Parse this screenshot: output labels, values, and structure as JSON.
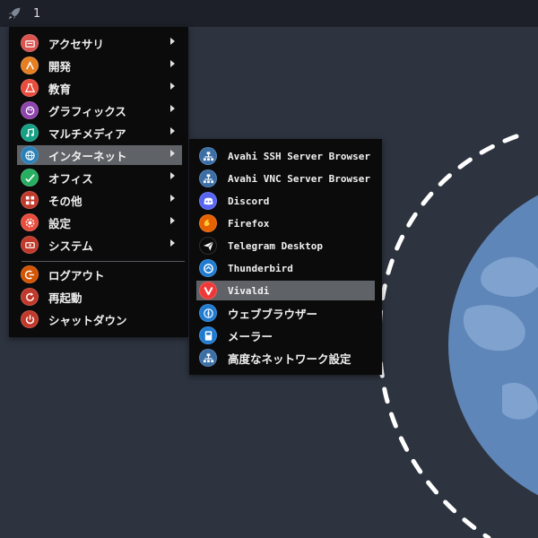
{
  "panel": {
    "workspace": "1"
  },
  "main_menu": {
    "items": [
      {
        "label": "アクセサリ",
        "icon": "accessories-icon",
        "color": "#d9534f",
        "submenu": true
      },
      {
        "label": "開発",
        "icon": "development-icon",
        "color": "#e67e22",
        "submenu": true
      },
      {
        "label": "教育",
        "icon": "education-icon",
        "color": "#e74c3c",
        "submenu": true
      },
      {
        "label": "グラフィックス",
        "icon": "graphics-icon",
        "color": "#8e44ad",
        "submenu": true
      },
      {
        "label": "マルチメディア",
        "icon": "multimedia-icon",
        "color": "#16a085",
        "submenu": true
      },
      {
        "label": "インターネット",
        "icon": "internet-icon",
        "color": "#2980b9",
        "submenu": true,
        "active": true
      },
      {
        "label": "オフィス",
        "icon": "office-icon",
        "color": "#27ae60",
        "submenu": true
      },
      {
        "label": "その他",
        "icon": "other-icon",
        "color": "#c0392b",
        "submenu": true
      },
      {
        "label": "設定",
        "icon": "settings-icon",
        "color": "#e74c3c",
        "submenu": true
      },
      {
        "label": "システム",
        "icon": "system-icon",
        "color": "#c0392b",
        "submenu": true
      }
    ],
    "session": [
      {
        "label": "ログアウト",
        "icon": "logout-icon",
        "color": "#d35400"
      },
      {
        "label": "再起動",
        "icon": "restart-icon",
        "color": "#c0392b"
      },
      {
        "label": "シャットダウン",
        "icon": "shutdown-icon",
        "color": "#c0392b"
      }
    ]
  },
  "internet_submenu": {
    "items": [
      {
        "label": "Avahi SSH Server Browser",
        "icon": "network-icon",
        "color": "#3b6ea5"
      },
      {
        "label": "Avahi VNC Server Browser",
        "icon": "network-icon",
        "color": "#3b6ea5"
      },
      {
        "label": "Discord",
        "icon": "discord-icon",
        "color": "#5865f2"
      },
      {
        "label": "Firefox",
        "icon": "firefox-icon",
        "color": "#e66000"
      },
      {
        "label": "Telegram Desktop",
        "icon": "telegram-icon",
        "color": "#0b0b0c"
      },
      {
        "label": "Thunderbird",
        "icon": "thunderbird-icon",
        "color": "#1f7bd0"
      },
      {
        "label": "Vivaldi",
        "icon": "vivaldi-icon",
        "color": "#ef3939",
        "active": true
      },
      {
        "label": "ウェブブラウザー",
        "icon": "web-browser-icon",
        "color": "#1f7bd0"
      },
      {
        "label": "メーラー",
        "icon": "mailer-icon",
        "color": "#1f7bd0"
      },
      {
        "label": "高度なネットワーク設定",
        "icon": "network-settings-icon",
        "color": "#3b6ea5"
      }
    ]
  }
}
